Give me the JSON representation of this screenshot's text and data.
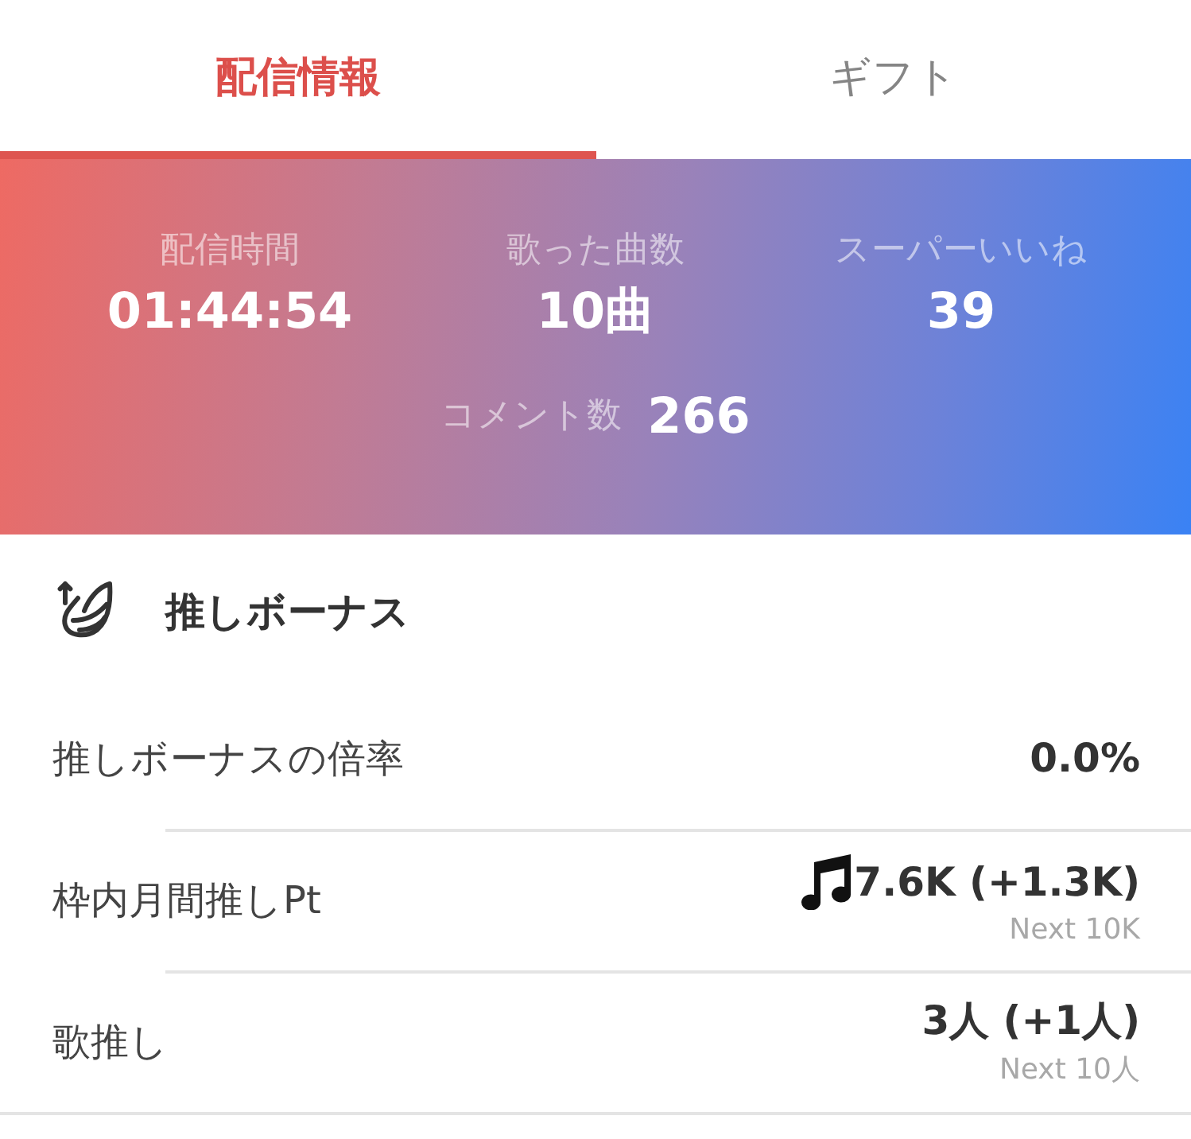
{
  "tabs": [
    {
      "label": "配信情報",
      "selected": true
    },
    {
      "label": "ギフト",
      "selected": false
    }
  ],
  "stats": [
    {
      "label": "配信時間",
      "value": "01:44:54"
    },
    {
      "label": "歌った曲数",
      "value": "10曲"
    },
    {
      "label": "スーパーいいね",
      "value": "39"
    }
  ],
  "comment_count": {
    "label": "コメント数",
    "value": "266"
  },
  "section": {
    "title": "推しボーナス"
  },
  "rows": [
    {
      "kind": "plain",
      "label": "推しボーナスの倍率",
      "value": "0.0%"
    },
    {
      "kind": "music",
      "label": "枠内月間推しPt",
      "value": "7.6K (+1.3K)",
      "next": "Next 10K"
    },
    {
      "kind": "plain",
      "label": "歌推し",
      "value": "3人 (+1人)",
      "next": "Next 10人"
    }
  ]
}
